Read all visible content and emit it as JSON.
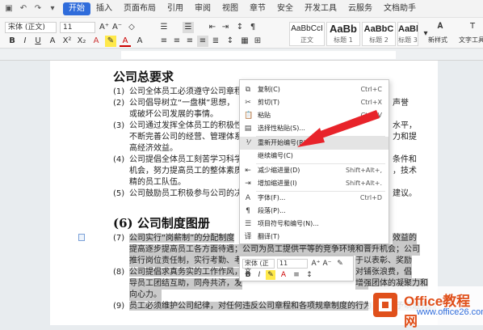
{
  "topbar": {
    "tabs": [
      "开始",
      "插入",
      "页面布局",
      "引用",
      "审阅",
      "视图",
      "章节",
      "安全",
      "开发工具",
      "云服务",
      "文档助手"
    ]
  },
  "ribbon": {
    "font_name": "宋体 (正文)",
    "font_size": "11",
    "styles": [
      {
        "preview": "AaBbCcI",
        "label": "正文"
      },
      {
        "preview": "AaBb",
        "label": "标题 1"
      },
      {
        "preview": "AaBbC",
        "label": "标题 2"
      },
      {
        "preview": "AaBbC",
        "label": "标题 3"
      }
    ],
    "new_style_label": "新样式",
    "text_tools_label": "文字工具"
  },
  "document": {
    "heading1": "公司总要求",
    "section1_lines": [
      {
        "num": "(1)",
        "text": "公司全体员工必须遵守公司章程"
      },
      {
        "num": "(2)",
        "text": "公司倡导树立“一盘棋”思想，"
      },
      {
        "num": "",
        "text": "或破坏公司发展的事情。"
      },
      {
        "num": "(3)",
        "text": "公司通过发挥全体员工的积极性"
      },
      {
        "num": "",
        "text": "不断完善公司的经营、管理体系"
      },
      {
        "num": "",
        "text": "高经济效益。"
      },
      {
        "num": "(4)",
        "text": "公司提倡全体员工刻苦学习科学"
      },
      {
        "num": "",
        "text": "机会，努力提高员工的整体素质"
      },
      {
        "num": "",
        "text": "精的员工队伍。"
      },
      {
        "num": "(5)",
        "text": "公司鼓励员工积极参与公司的决"
      }
    ],
    "section1_right": [
      "声誉",
      "水平，",
      "力和提",
      "条件和",
      "，技术",
      "建议。"
    ],
    "heading2": "(6) 公司制度图册",
    "section2_lines": [
      {
        "num": "(7)",
        "text": "公司实行“岗薪制”的分配制度"
      },
      {
        "num": "",
        "text": "提高逐步提高员工各方面待遇；公司为员工提供平等的竞争环境和晋升机会；公司"
      },
      {
        "num": "",
        "text": "推行岗位责任制，实行考勤、考"
      },
      {
        "num": "(8)",
        "text": "公司提倡求真务实的工作作风，"
      },
      {
        "num": "",
        "text": "导员工团结互助，同舟共济，发"
      },
      {
        "num": "",
        "text": "向心力。"
      },
      {
        "num": "(9)",
        "text": "员工必须维护公司纪律，对任何违反公司章程和各项规章制度的行为，都要予以追究。"
      }
    ],
    "section2_right": [
      "效益的",
      "于以表彰、奖励",
      "对铺张浪费，倡",
      "增强团体的凝聚力和"
    ]
  },
  "context_menu": {
    "items": [
      {
        "icon": "copy-icon",
        "label": "复制(C)",
        "shortcut": "Ctrl+C"
      },
      {
        "icon": "cut-icon",
        "label": "剪切(T)",
        "shortcut": "Ctrl+X"
      },
      {
        "icon": "paste-icon",
        "label": "粘贴",
        "shortcut": "Ctrl+V"
      },
      {
        "icon": "paste-special-icon",
        "label": "选择性粘贴(S)...",
        "shortcut": ""
      },
      {
        "icon": "restart-numbering-icon",
        "label": "重新开始编号(R)",
        "shortcut": ""
      },
      {
        "icon": "",
        "label": "继续编号(C)",
        "shortcut": ""
      },
      {
        "icon": "decrease-indent-icon",
        "label": "减少缩进量(D)",
        "shortcut": "Shift+Alt+,"
      },
      {
        "icon": "increase-indent-icon",
        "label": "增加缩进量(I)",
        "shortcut": "Shift+Alt+."
      },
      {
        "icon": "font-icon",
        "label": "字体(F)...",
        "shortcut": "Ctrl+D"
      },
      {
        "icon": "paragraph-icon",
        "label": "段落(P)...",
        "shortcut": ""
      },
      {
        "icon": "bullets-numbering-icon",
        "label": "项目符号和编号(N)...",
        "shortcut": ""
      },
      {
        "icon": "translate-icon",
        "label": "翻译(T)",
        "shortcut": ""
      }
    ],
    "highlighted_index": 4
  },
  "mini_toolbar": {
    "font_name": "宋体 (正文",
    "font_size": "11"
  },
  "watermark": {
    "title": "Office教程网",
    "url": "www.office26.com"
  },
  "colors": {
    "accent": "#2f6cdb",
    "arrow": "#e8232a",
    "brand_orange": "#e0501b",
    "selection": "#c9c9c9"
  }
}
